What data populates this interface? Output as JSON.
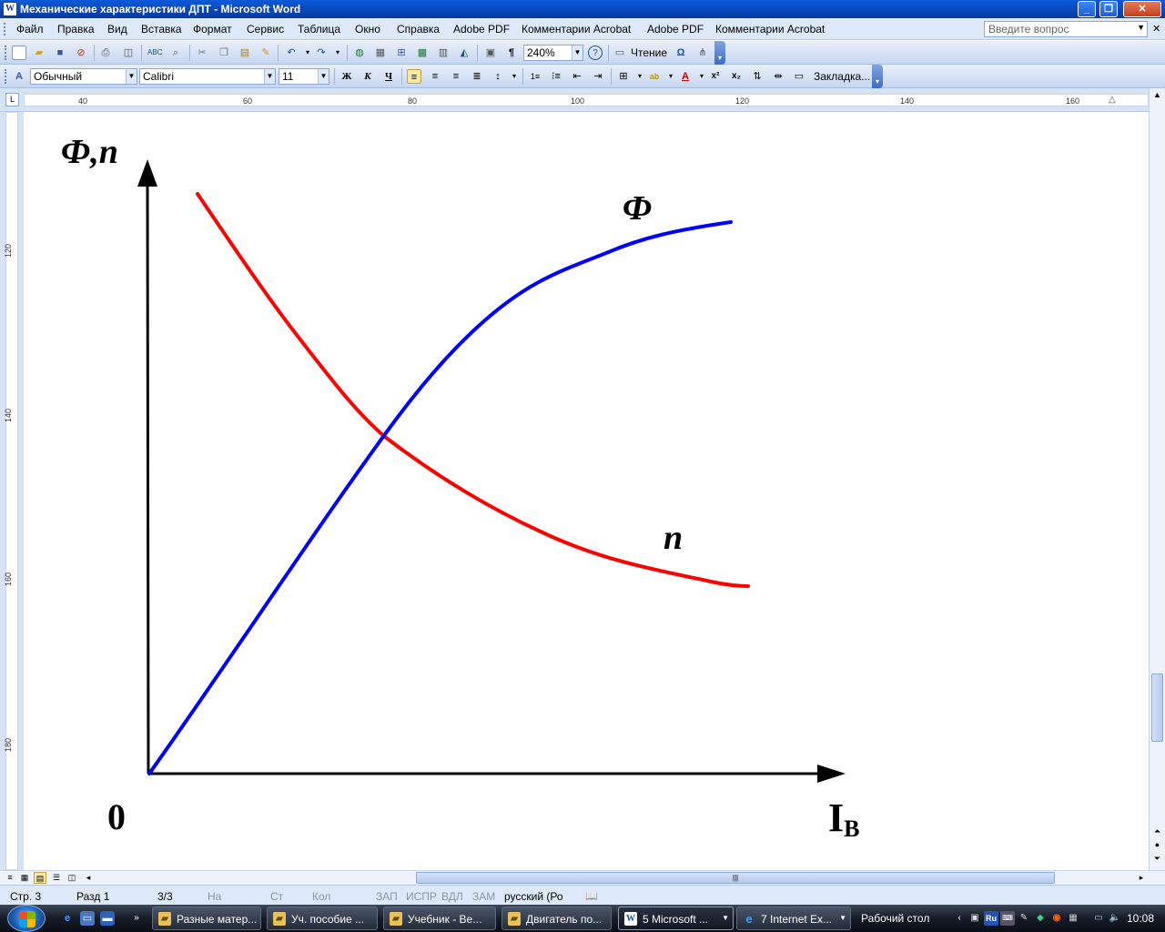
{
  "window": {
    "title": "Механические характеристики ДПТ - Microsoft Word",
    "icon": "word-doc-icon",
    "min_icon": "minimize-icon",
    "max_icon": "restore-icon",
    "close_icon": "close-icon"
  },
  "menubar": {
    "items": [
      "Файл",
      "Правка",
      "Вид",
      "Вставка",
      "Формат",
      "Сервис",
      "Таблица",
      "Окно",
      "Справка",
      "Adobe PDF",
      "Комментарии Acrobat",
      "Adobe PDF",
      "Комментарии Acrobat"
    ],
    "help_placeholder": "Введите вопрос"
  },
  "toolbar1": {
    "zoom": "240%",
    "reading_label": "Чтение",
    "icons": [
      "new-doc-icon",
      "open-icon",
      "save-icon",
      "permission-icon",
      "print-icon",
      "print-preview-icon",
      "spelling-icon",
      "research-icon",
      "cut-icon",
      "copy-icon",
      "paste-icon",
      "format-painter-icon",
      "undo-icon",
      "redo-icon",
      "hyperlink-icon",
      "tables-borders-icon",
      "insert-table-icon",
      "insert-excel-icon",
      "columns-icon",
      "drawing-icon",
      "document-map-icon",
      "show-marks-icon",
      "help-icon",
      "reading-icon",
      "symbol-icon",
      "more-icon"
    ]
  },
  "toolbar2": {
    "style": "Обычный",
    "font": "Calibri",
    "size": "11",
    "bold_label": "Ж",
    "italic_label": "К",
    "underline_label": "Ч",
    "bookmark_label": "Закладка..."
  },
  "ruler": {
    "h_ticks": [
      "40",
      "60",
      "80",
      "100",
      "120",
      "140",
      "160"
    ],
    "v_ticks": [
      "120",
      "140",
      "160",
      "180"
    ]
  },
  "figure": {
    "y_axis_label": "Ф,n",
    "x_axis_label": "I",
    "x_axis_sub": "В",
    "origin_label": "0",
    "curve_flux_label": "Ф",
    "curve_speed_label": "n",
    "flux_color": "#0000ff",
    "speed_color": "#ff0000"
  },
  "statusbar": {
    "page": "Стр. 3",
    "section": "Разд 1",
    "pages": "3/3",
    "at": "На",
    "line": "Ст",
    "col": "Кол",
    "rec": "ЗАП",
    "trk": "ИСПР",
    "ext": "ВДЛ",
    "ovr": "ЗАМ",
    "language": "русский (Ро"
  },
  "taskbar": {
    "tasks": [
      {
        "label": "Разные матер...",
        "icon": "folder-icon"
      },
      {
        "label": "Уч. пособие ...",
        "icon": "folder-icon"
      },
      {
        "label": "Учебник - Ве...",
        "icon": "folder-icon"
      },
      {
        "label": "Двигатель по...",
        "icon": "folder-icon"
      },
      {
        "label": "5 Microsoft ...",
        "icon": "word-icon"
      },
      {
        "label": "7 Internet Ex...",
        "icon": "ie-icon"
      }
    ],
    "desktop_label": "Рабочий стол",
    "lang_indicator": "Ru",
    "clock": "10:08"
  }
}
